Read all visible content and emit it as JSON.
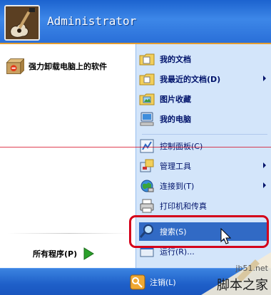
{
  "header": {
    "user_name": "Administrator"
  },
  "left": {
    "pinned": [
      {
        "label": "强力卸载电脑上的软件",
        "icon": "uninstall-box-icon"
      }
    ],
    "all_programs_label": "所有程序(P)"
  },
  "right": {
    "items": [
      {
        "label": "我的文档",
        "icon": "folder-documents-icon",
        "bold": true,
        "submenu": false
      },
      {
        "label": "我最近的文档(D)",
        "icon": "folder-recent-icon",
        "bold": true,
        "submenu": true
      },
      {
        "label": "图片收藏",
        "icon": "folder-pictures-icon",
        "bold": true,
        "submenu": false
      },
      {
        "label": "我的电脑",
        "icon": "computer-icon",
        "bold": true,
        "submenu": false
      },
      {
        "label": "控制面板(C)",
        "icon": "control-panel-icon",
        "bold": false,
        "submenu": false
      },
      {
        "label": "管理工具",
        "icon": "admin-tools-icon",
        "bold": false,
        "submenu": true
      },
      {
        "label": "连接到(T)",
        "icon": "connect-to-icon",
        "bold": false,
        "submenu": true
      },
      {
        "label": "打印机和传真",
        "icon": "printer-icon",
        "bold": false,
        "submenu": false
      },
      {
        "label": "搜索(S)",
        "icon": "search-icon",
        "bold": false,
        "submenu": false,
        "selected": true
      },
      {
        "label": "运行(R)...",
        "icon": "run-icon",
        "bold": false,
        "submenu": false
      }
    ]
  },
  "bottom": {
    "logoff_label": "注销(L)"
  },
  "watermark": {
    "url": "jb51.net",
    "text": "脚本之家"
  },
  "colors": {
    "selection": "#316ac5",
    "annotation": "#d4001a",
    "right_pane": "#d3e5fa",
    "header_blue": "#2a6fd8"
  }
}
